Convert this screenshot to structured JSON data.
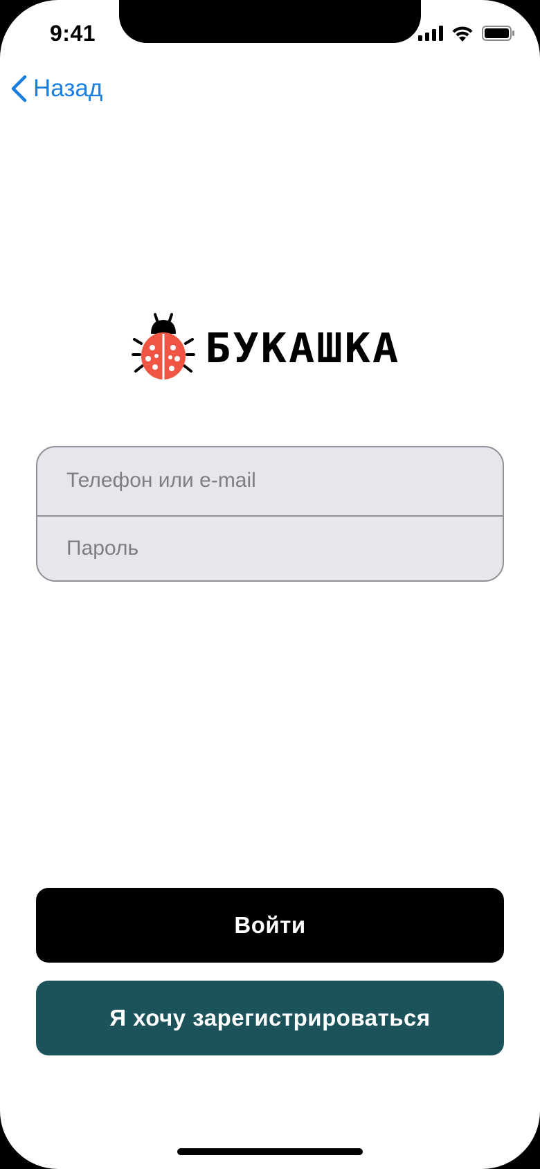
{
  "status_bar": {
    "time": "9:41"
  },
  "nav": {
    "back_label": "Назад"
  },
  "logo": {
    "wordmark": "БУКАШКА"
  },
  "form": {
    "login_placeholder": "Телефон или e-mail",
    "password_placeholder": "Пароль"
  },
  "actions": {
    "login_label": "Войти",
    "register_label": "Я хочу зарегистрироваться"
  },
  "colors": {
    "accent_link": "#1a7fe0",
    "login_button": "#000000",
    "register_button": "#1c535b",
    "ladybug": "#f05544",
    "field_background": "#e6e6ed"
  },
  "icons": {
    "back": "chevron-left-icon",
    "signal": "cellular-signal-icon",
    "wifi": "wifi-icon",
    "battery": "battery-icon",
    "logo_mark": "ladybug-icon"
  }
}
